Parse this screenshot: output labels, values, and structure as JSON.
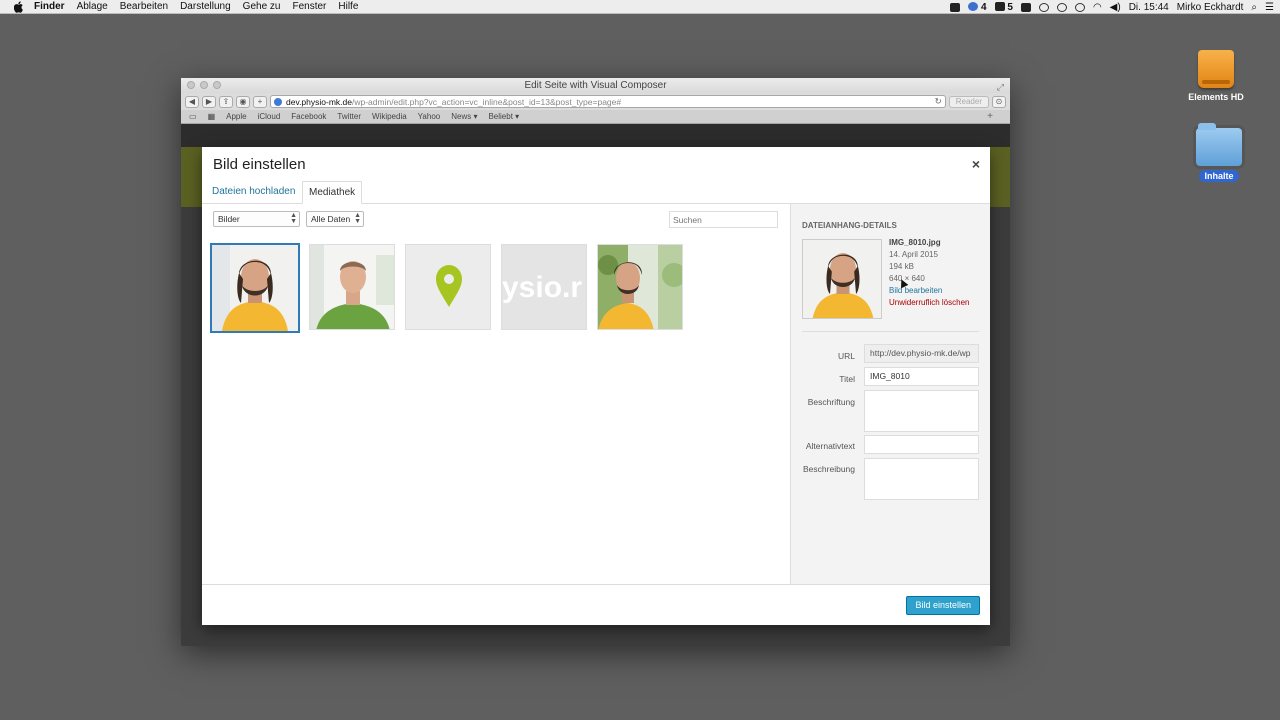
{
  "menubar": {
    "items": [
      "Finder",
      "Ablage",
      "Bearbeiten",
      "Darstellung",
      "Gehe zu",
      "Fenster",
      "Hilfe"
    ],
    "tray_count_a": "4",
    "tray_count_b": "5",
    "clock": "Di. 15:44",
    "user": "Mirko Eckhardt"
  },
  "desktop": {
    "drive_label": "Elements HD",
    "folder_label": "Inhalte"
  },
  "browser": {
    "window_title": "Edit Seite with Visual Composer",
    "url_domain": "dev.physio-mk.de",
    "url_path": "/wp-admin/edit.php?vc_action=vc_inline&post_id=13&post_type=page#",
    "reader_label": "Reader",
    "bookmarks": [
      "Apple",
      "iCloud",
      "Facebook",
      "Twitter",
      "Wikipedia",
      "Yahoo",
      "News ▾",
      "Beliebt ▾"
    ]
  },
  "modal": {
    "title": "Bild einstellen",
    "close": "×",
    "tabs": [
      "Dateien hochladen",
      "Mediathek"
    ],
    "filter_type": "Bilder",
    "filter_date": "Alle Daten",
    "search_placeholder": "Suchen",
    "thumb_text": "ysio.r",
    "details": {
      "heading": "DATEIANHANG-DETAILS",
      "filename": "IMG_8010.jpg",
      "date": "14. April 2015",
      "size": "194 kB",
      "dimensions": "640 × 640",
      "edit_link": "Bild bearbeiten",
      "delete_link": "Unwiderruflich löschen"
    },
    "fields": {
      "url_label": "URL",
      "url_value": "http://dev.physio-mk.de/wp",
      "title_label": "Titel",
      "title_value": "IMG_8010",
      "caption_label": "Beschriftung",
      "alt_label": "Alternativtext",
      "description_label": "Beschreibung"
    },
    "primary_button": "Bild einstellen"
  },
  "colors": {
    "accent": "#2ea2cc",
    "selected_border": "#2f7ab7",
    "link": "#21759b",
    "delete": "#aa0000"
  }
}
